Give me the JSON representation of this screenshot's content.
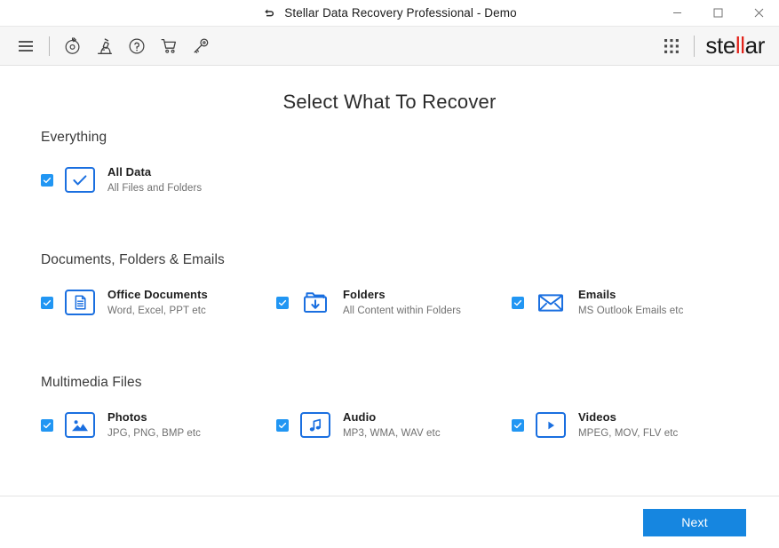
{
  "window": {
    "title": "Stellar Data Recovery Professional - Demo",
    "back_icon": "back-arrow-icon",
    "minimize_label": "Minimize",
    "maximize_label": "Maximize",
    "close_label": "Close"
  },
  "toolbar": {
    "items": [
      {
        "name": "menu-icon",
        "label": "Menu"
      },
      {
        "name": "recovery-icon",
        "label": "Recover Data"
      },
      {
        "name": "microscope-icon",
        "label": "Monitor Drive"
      },
      {
        "name": "help-icon",
        "label": "Help"
      },
      {
        "name": "cart-icon",
        "label": "Buy Now"
      },
      {
        "name": "key-icon",
        "label": "Activation"
      }
    ],
    "apps_grid_icon": "grid-dots-icon",
    "brand": {
      "prefix": "ste",
      "highlight": "ll",
      "suffix": "ar",
      "highlight_color": "#e2231a"
    }
  },
  "main": {
    "heading": "Select What To Recover",
    "sections": [
      {
        "id": "everything",
        "title": "Everything",
        "options": [
          {
            "id": "all-data",
            "title": "All Data",
            "subtitle": "All Files and Folders",
            "icon": "check-box-icon",
            "checked": true
          }
        ]
      },
      {
        "id": "documents",
        "title": "Documents, Folders & Emails",
        "options": [
          {
            "id": "office-documents",
            "title": "Office Documents",
            "subtitle": "Word, Excel, PPT etc",
            "icon": "document-icon",
            "checked": true
          },
          {
            "id": "folders",
            "title": "Folders",
            "subtitle": "All Content within Folders",
            "icon": "folder-download-icon",
            "checked": true
          },
          {
            "id": "emails",
            "title": "Emails",
            "subtitle": "MS Outlook Emails etc",
            "icon": "envelope-icon",
            "checked": true
          }
        ]
      },
      {
        "id": "multimedia",
        "title": "Multimedia Files",
        "options": [
          {
            "id": "photos",
            "title": "Photos",
            "subtitle": "JPG, PNG, BMP etc",
            "icon": "image-icon",
            "checked": true
          },
          {
            "id": "audio",
            "title": "Audio",
            "subtitle": "MP3, WMA, WAV etc",
            "icon": "music-note-icon",
            "checked": true
          },
          {
            "id": "videos",
            "title": "Videos",
            "subtitle": "MPEG, MOV, FLV etc",
            "icon": "play-icon",
            "checked": true
          }
        ]
      }
    ]
  },
  "footer": {
    "next_label": "Next",
    "next_color": "#1686e0"
  }
}
